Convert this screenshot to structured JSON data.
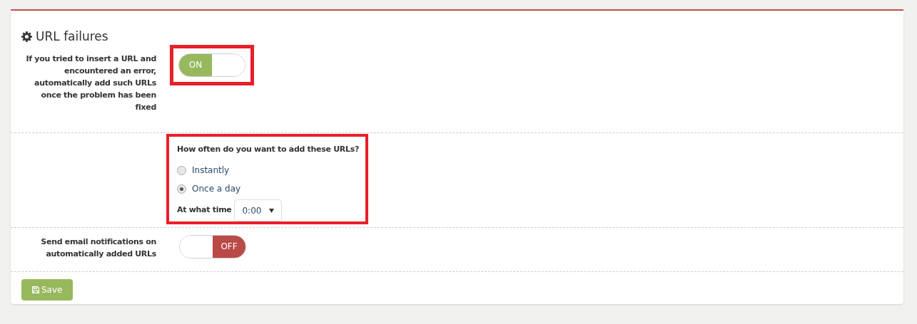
{
  "section": {
    "title": "URL failures"
  },
  "auto_add": {
    "label": "If you tried to insert a URL and encountered an error, automatically add such URLs once the problem has been fixed",
    "on": true,
    "text": "ON",
    "highlighted": true
  },
  "frequency": {
    "question": "How often do you want to add these URLs?",
    "highlighted": true,
    "options": [
      {
        "label": "Instantly",
        "selected": false
      },
      {
        "label": "Once a day",
        "selected": true
      }
    ],
    "time_label": "At what time",
    "time_value": "0:00"
  },
  "email": {
    "label": "Send email notifications on automatically added URLs",
    "on": false,
    "text": "OFF",
    "highlighted": false
  },
  "save_button": "Save"
}
